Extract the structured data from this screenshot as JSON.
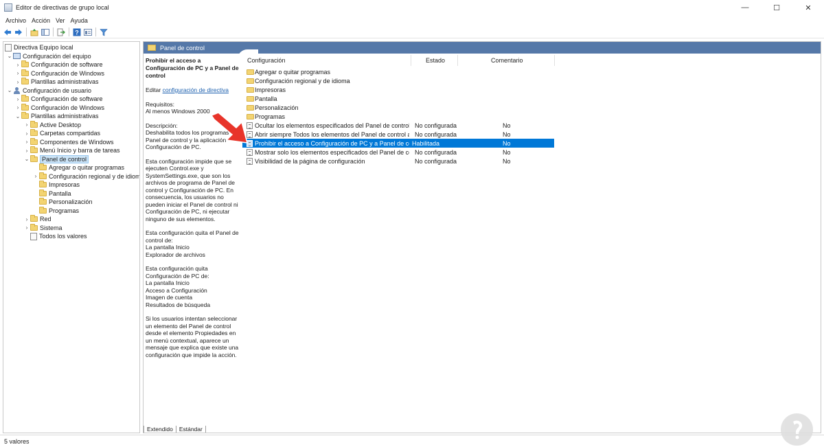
{
  "window": {
    "title": "Editor de directivas de grupo local",
    "minimize": "—",
    "maximize": "☐",
    "close": "✕"
  },
  "menu": [
    "Archivo",
    "Acción",
    "Ver",
    "Ayuda"
  ],
  "toolbar": {
    "icons": [
      "back-icon",
      "forward-icon",
      "up-folder-icon",
      "show-hide-tree-icon",
      "export-list-icon",
      "help-icon",
      "properties-icon",
      "filter-icon"
    ]
  },
  "tree": {
    "root": "Directiva Equipo local",
    "computer": "Configuración del equipo",
    "computer_children": [
      "Configuración de software",
      "Configuración de Windows",
      "Plantillas administrativas"
    ],
    "user": "Configuración de usuario",
    "user_children": [
      "Configuración de software",
      "Configuración de Windows",
      "Plantillas administrativas"
    ],
    "admin_children": [
      "Active Desktop",
      "Carpetas compartidas",
      "Componentes de Windows",
      "Menú Inicio y barra de tareas",
      "Panel de control"
    ],
    "panel_children": [
      "Agregar o quitar programas",
      "Configuración regional y de idioma",
      "Impresoras",
      "Pantalla",
      "Personalización",
      "Programas"
    ],
    "after_panel": [
      "Red",
      "Sistema",
      "Todos los valores"
    ]
  },
  "header": {
    "title": "Panel de control"
  },
  "description": {
    "policy_title": "Prohibir el acceso a Configuración de PC y a Panel de control",
    "edit_prefix": "Editar",
    "edit_link": "configuración de directiva",
    "requirements_label": "Requisitos:",
    "requirements_value": "Al menos Windows 2000",
    "description_label": "Descripción:",
    "p1": "Deshabilita todos los programas del Panel de control y la aplicación Configuración de PC.",
    "p2": "Esta configuración impide que se ejecuten Control.exe y SystemSettings.exe, que son los archivos de programa de Panel de control y Configuración de PC. En consecuencia, los usuarios no pueden iniciar el Panel de control ni Configuración de PC, ni ejecutar ninguno de sus elementos.",
    "p3_line1": "Esta configuración quita el Panel de control de:",
    "p3_line2": "La pantalla Inicio",
    "p3_line3": "Explorador de archivos",
    "p4_line1": "Esta configuración quita Configuración de PC de:",
    "p4_line2": "La pantalla Inicio",
    "p4_line3": "Acceso a Configuración",
    "p4_line4": "Imagen de cuenta",
    "p4_line5": "Resultados de búsqueda",
    "p5": "Si los usuarios intentan seleccionar un elemento del Panel de control desde el elemento Propiedades en un menú contextual, aparece un mensaje que explica que existe una configuración que impide la acción."
  },
  "list": {
    "columns": [
      "Configuración",
      "Estado",
      "Comentario"
    ],
    "folders": [
      "Agregar o quitar programas",
      "Configuración regional y de idioma",
      "Impresoras",
      "Pantalla",
      "Personalización",
      "Programas"
    ],
    "policies": [
      {
        "name": "Ocultar los elementos especificados del Panel de control",
        "state": "No configurada",
        "comment": "No"
      },
      {
        "name": "Abrir siempre Todos los elementos del Panel de control al ab...",
        "state": "No configurada",
        "comment": "No"
      },
      {
        "name": "Prohibir el acceso a Configuración de PC y a Panel de control",
        "state": "Habilitada",
        "comment": "No"
      },
      {
        "name": "Mostrar solo los elementos especificados del Panel de control",
        "state": "No configurada",
        "comment": "No"
      },
      {
        "name": "Visibilidad de la página de configuración",
        "state": "No configurada",
        "comment": "No"
      }
    ]
  },
  "tabs": [
    "Extendido",
    "Estándar"
  ],
  "status": {
    "text": "5 valores"
  },
  "colors": {
    "header_bg": "#5578a8",
    "selection": "#0078d7",
    "arrow": "#e8342a",
    "folder": "#f3d472"
  }
}
